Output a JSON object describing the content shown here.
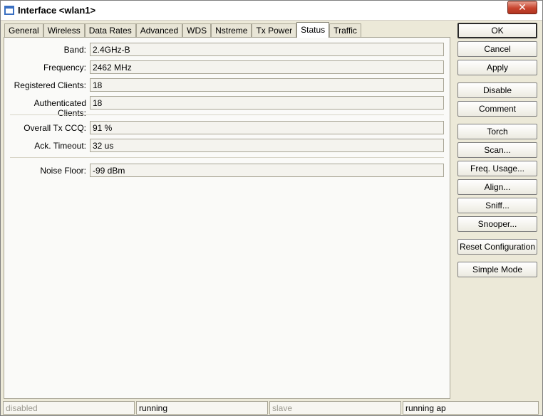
{
  "window": {
    "title": "Interface <wlan1>",
    "close_glyph": "✕"
  },
  "tabs": [
    {
      "label": "General",
      "active": false
    },
    {
      "label": "Wireless",
      "active": false
    },
    {
      "label": "Data Rates",
      "active": false
    },
    {
      "label": "Advanced",
      "active": false
    },
    {
      "label": "WDS",
      "active": false
    },
    {
      "label": "Nstreme",
      "active": false
    },
    {
      "label": "Tx Power",
      "active": false
    },
    {
      "label": "Status",
      "active": true
    },
    {
      "label": "Traffic",
      "active": false
    }
  ],
  "status": {
    "band": {
      "label": "Band:",
      "value": "2.4GHz-B"
    },
    "frequency": {
      "label": "Frequency:",
      "value": "2462 MHz"
    },
    "registered_clients": {
      "label": "Registered Clients:",
      "value": "18"
    },
    "authenticated_clients": {
      "label": "Authenticated Clients:",
      "value": "18"
    },
    "overall_tx_ccq": {
      "label": "Overall Tx CCQ:",
      "value": "91 %"
    },
    "ack_timeout": {
      "label": "Ack. Timeout:",
      "value": "32 us"
    },
    "noise_floor": {
      "label": "Noise Floor:",
      "value": "-99 dBm"
    }
  },
  "buttons": {
    "ok": "OK",
    "cancel": "Cancel",
    "apply": "Apply",
    "disable": "Disable",
    "comment": "Comment",
    "torch": "Torch",
    "scan": "Scan...",
    "freq_usage": "Freq. Usage...",
    "align": "Align...",
    "sniff": "Sniff...",
    "snooper": "Snooper...",
    "reset_configuration": "Reset Configuration",
    "simple_mode": "Simple Mode"
  },
  "statusbar": [
    "disabled",
    "running",
    "slave",
    "running ap"
  ],
  "colors": {
    "window_bg": "#ece9d8",
    "panel_bg": "#fafaf8",
    "close_red": "#c8452f"
  }
}
